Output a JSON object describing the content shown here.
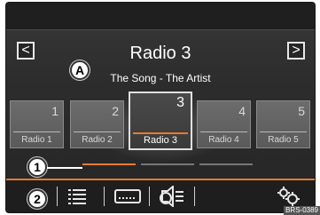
{
  "nav": {
    "prev_symbol": "<",
    "next_symbol": ">"
  },
  "station": {
    "name": "Radio 3",
    "track": "The Song - The Artist"
  },
  "markers": {
    "a": "A",
    "one": "1",
    "two": "2"
  },
  "presets": [
    {
      "number": "1",
      "label": "Radio 1",
      "active": false
    },
    {
      "number": "2",
      "label": "Radio 2",
      "active": false
    },
    {
      "number": "3",
      "label": "Radio 3",
      "active": true
    },
    {
      "number": "4",
      "label": "Radio 4",
      "active": false
    },
    {
      "number": "5",
      "label": "Radio 5",
      "active": false
    }
  ],
  "pagination": {
    "pages": 3,
    "current": 1
  },
  "bottom_bar": {
    "icons": [
      "list-icon",
      "keypad-icon",
      "sound-icon",
      "settings-gears-icon"
    ]
  },
  "colors": {
    "accent": "#e87b2a",
    "background": "#2c2c2c"
  },
  "credit": "BRS-0389"
}
